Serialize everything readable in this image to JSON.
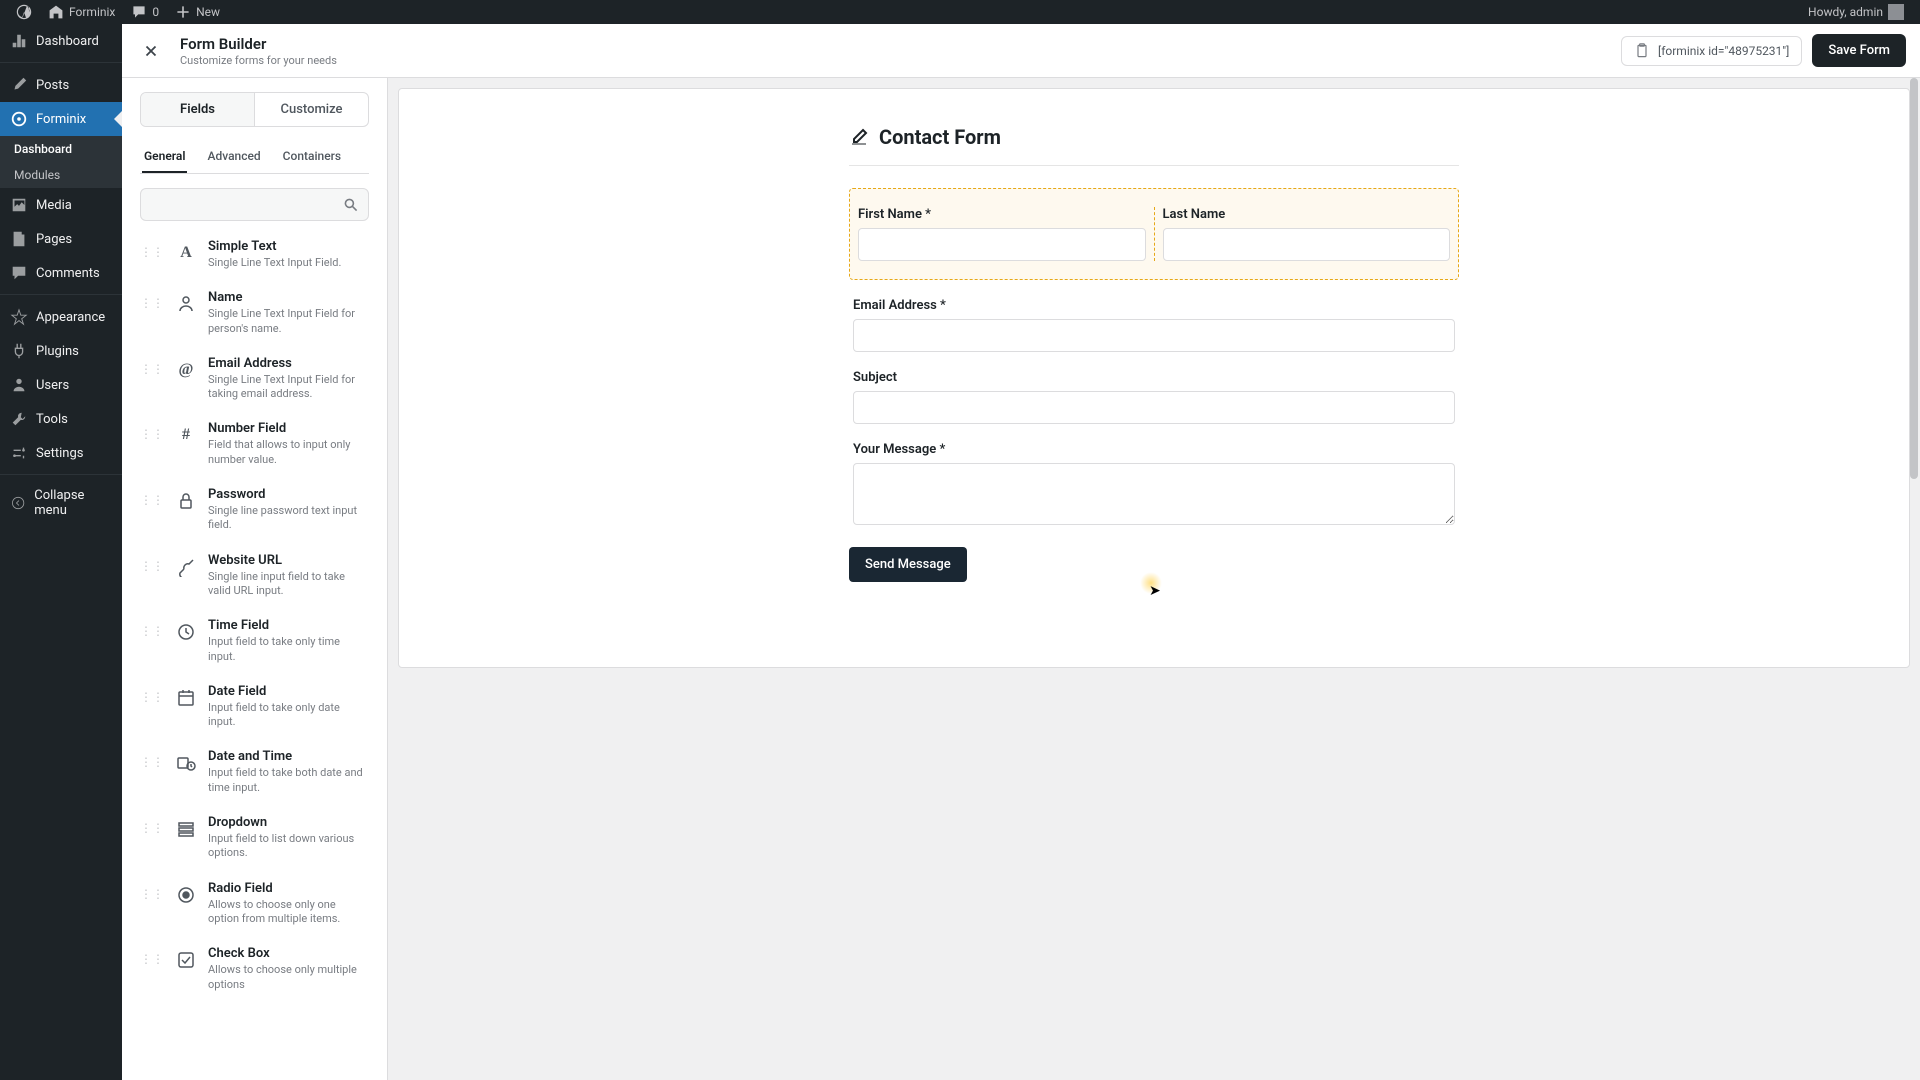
{
  "adminbar": {
    "site": "Forminix",
    "comments": "0",
    "new": "New",
    "howdy": "Howdy, admin"
  },
  "sidebar": {
    "items": [
      {
        "label": "Dashboard"
      },
      {
        "label": "Posts"
      },
      {
        "label": "Forminix"
      },
      {
        "label": "Media"
      },
      {
        "label": "Pages"
      },
      {
        "label": "Comments"
      },
      {
        "label": "Appearance"
      },
      {
        "label": "Plugins"
      },
      {
        "label": "Users"
      },
      {
        "label": "Tools"
      },
      {
        "label": "Settings"
      },
      {
        "label": "Collapse menu"
      }
    ],
    "submenu": [
      {
        "label": "Dashboard"
      },
      {
        "label": "Modules"
      }
    ]
  },
  "header": {
    "title": "Form Builder",
    "subtitle": "Customize forms for your needs",
    "shortcode": "[forminix id=\"48975231\"]",
    "save": "Save Form"
  },
  "panel": {
    "maintabs": [
      "Fields",
      "Customize"
    ],
    "subtabs": [
      "General",
      "Advanced",
      "Containers"
    ],
    "fields": [
      {
        "title": "Simple Text",
        "desc": "Single Line Text Input Field."
      },
      {
        "title": "Name",
        "desc": "Single Line Text Input Field for person's name."
      },
      {
        "title": "Email Address",
        "desc": "Single Line Text Input Field for taking email address."
      },
      {
        "title": "Number Field",
        "desc": "Field that allows to input only number value."
      },
      {
        "title": "Password",
        "desc": "Single line password text input field."
      },
      {
        "title": "Website URL",
        "desc": "Single line input field to take valid URL input."
      },
      {
        "title": "Time Field",
        "desc": "Input field to take only time input."
      },
      {
        "title": "Date Field",
        "desc": "Input field to take only date input."
      },
      {
        "title": "Date and Time",
        "desc": "Input field to take both date and time input."
      },
      {
        "title": "Dropdown",
        "desc": "Input field to list down various options."
      },
      {
        "title": "Radio Field",
        "desc": "Allows to choose only one option from multiple items."
      },
      {
        "title": "Check Box",
        "desc": "Allows to choose only multiple options"
      }
    ]
  },
  "form": {
    "title": "Contact Form",
    "first_name": "First Name *",
    "last_name": "Last Name",
    "email": "Email Address *",
    "subject": "Subject",
    "message": "Your Message *",
    "submit": "Send Message"
  }
}
